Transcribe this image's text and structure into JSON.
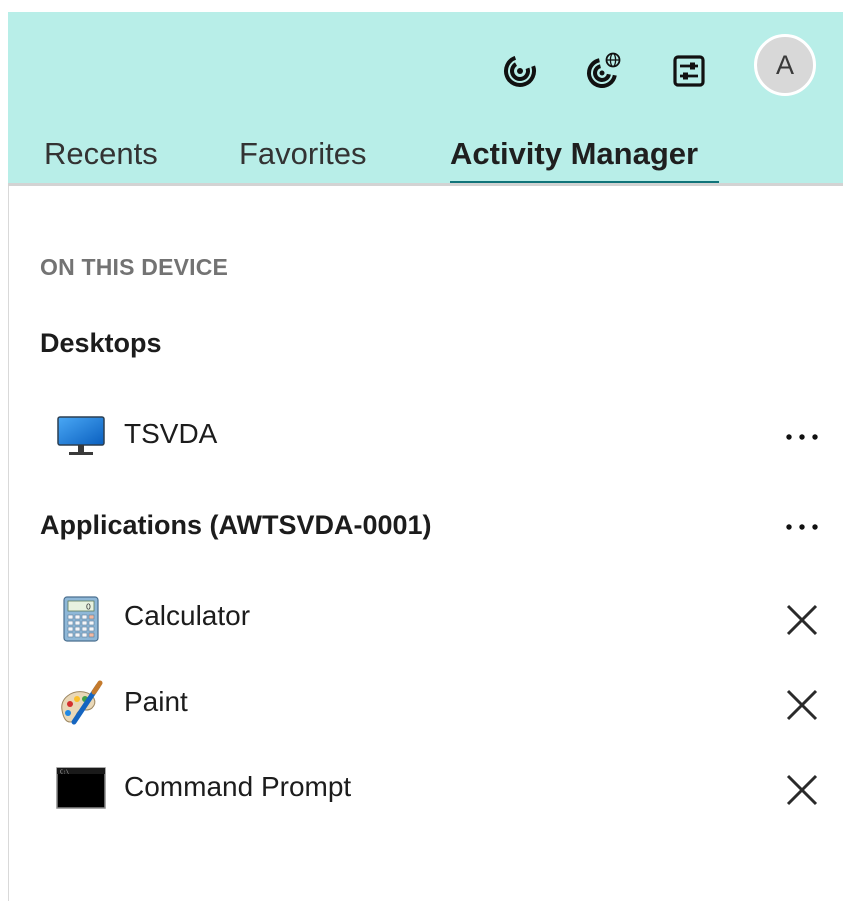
{
  "header": {
    "icons": [
      "activity-rings-icon",
      "activity-globe-icon",
      "preferences-sliders-icon"
    ],
    "avatar_letter": "A",
    "colors": {
      "background": "#b8eee8",
      "active_tab_underline": "#11747a"
    }
  },
  "tabs": [
    {
      "label": "Recents",
      "active": false
    },
    {
      "label": "Favorites",
      "active": false
    },
    {
      "label": "Activity Manager",
      "active": true
    }
  ],
  "section": {
    "label": "ON THIS DEVICE",
    "desktops": {
      "title": "Desktops",
      "items": [
        {
          "label": "TSVDA",
          "icon": "monitor-icon",
          "action": "more-options"
        }
      ]
    },
    "applications": {
      "title": "Applications (AWTSVDA-0001)",
      "items": [
        {
          "label": "Calculator",
          "icon": "calculator-icon",
          "action": "close"
        },
        {
          "label": "Paint",
          "icon": "paint-palette-icon",
          "action": "close"
        },
        {
          "label": "Command Prompt",
          "icon": "command-prompt-icon",
          "action": "close"
        }
      ]
    }
  }
}
